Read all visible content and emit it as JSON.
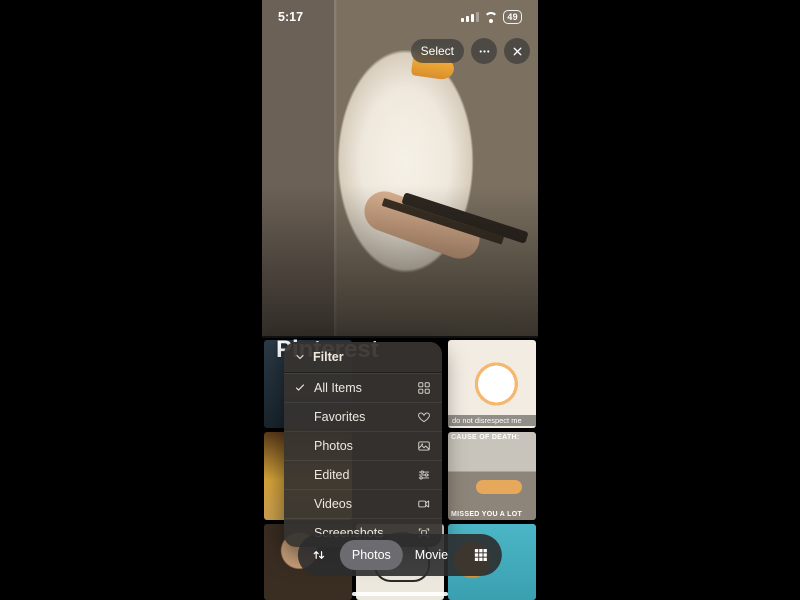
{
  "status": {
    "time": "5:17",
    "battery": "49"
  },
  "header": {
    "select_label": "Select",
    "album_title": "Pinterest"
  },
  "filter": {
    "title": "Filter",
    "items": [
      {
        "label": "All Items",
        "checked": true,
        "icon": "grid2"
      },
      {
        "label": "Favorites",
        "checked": false,
        "icon": "heart"
      },
      {
        "label": "Photos",
        "checked": false,
        "icon": "photo"
      },
      {
        "label": "Edited",
        "checked": false,
        "icon": "sliders"
      },
      {
        "label": "Videos",
        "checked": false,
        "icon": "video"
      },
      {
        "label": "Screenshots",
        "checked": false,
        "icon": "screenshot"
      }
    ]
  },
  "thumbnails": {
    "t3_caption": "do not disrespect me",
    "t6_top": "CAUSE OF DEATH:",
    "t6_bottom": "MISSED YOU A LOT"
  },
  "toolbar": {
    "photos_label": "Photos",
    "movie_label": "Movie"
  }
}
